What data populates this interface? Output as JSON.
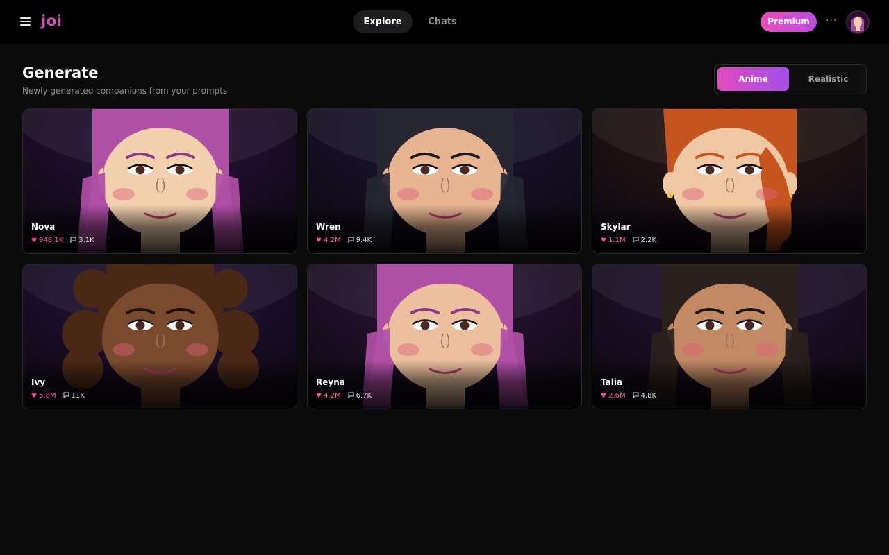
{
  "header": {
    "logo": "joi",
    "tabs": [
      {
        "label": "Explore",
        "active": true
      },
      {
        "label": "Chats",
        "active": false
      }
    ],
    "premium_label": "Premium",
    "more_label": "···"
  },
  "page": {
    "title": "Generate",
    "subtitle": "Newly generated companions from your prompts"
  },
  "style_toggle": {
    "options": [
      "Anime",
      "Realistic"
    ],
    "selected": "Anime"
  },
  "colors": {
    "accent_gradient_start": "#ea4fb8",
    "accent_gradient_end": "#a24fe8",
    "logo": "#d24fc0",
    "likes": "#ff5ea6"
  },
  "companions": [
    {
      "name": "Nova",
      "likes": "948.1K",
      "chats": "3.1K",
      "skin": "#f3d0ad",
      "hair": "#b04fa6",
      "bg": "#2a1238",
      "eyebrow": "#8a3a86",
      "style": "straight"
    },
    {
      "name": "Wren",
      "likes": "4.2M",
      "chats": "9.4K",
      "skin": "#e8b592",
      "hair": "#262633",
      "bg": "#1b1630",
      "eyebrow": "#1a1a1a",
      "style": "straight"
    },
    {
      "name": "Skylar",
      "likes": "1.1M",
      "chats": "2.2K",
      "skin": "#f0c7a3",
      "hair": "#c5541f",
      "bg": "#2a1a10",
      "eyebrow": "#c5541f",
      "style": "sidepart"
    },
    {
      "name": "Ivy",
      "likes": "5.8M",
      "chats": "11K",
      "skin": "#7a4a2e",
      "hair": "#4a2816",
      "bg": "#24133a",
      "eyebrow": "#1f1208",
      "style": "buns"
    },
    {
      "name": "Reyna",
      "likes": "4.2M",
      "chats": "6.7K",
      "skin": "#ecc09f",
      "hair": "#b04fa6",
      "bg": "#2e1638",
      "eyebrow": "#8a3a86",
      "style": "straight"
    },
    {
      "name": "Talia",
      "likes": "2.6M",
      "chats": "4.8K",
      "skin": "#c28a64",
      "hair": "#2a201c",
      "bg": "#241430",
      "eyebrow": "#1f1510",
      "style": "straight"
    }
  ]
}
